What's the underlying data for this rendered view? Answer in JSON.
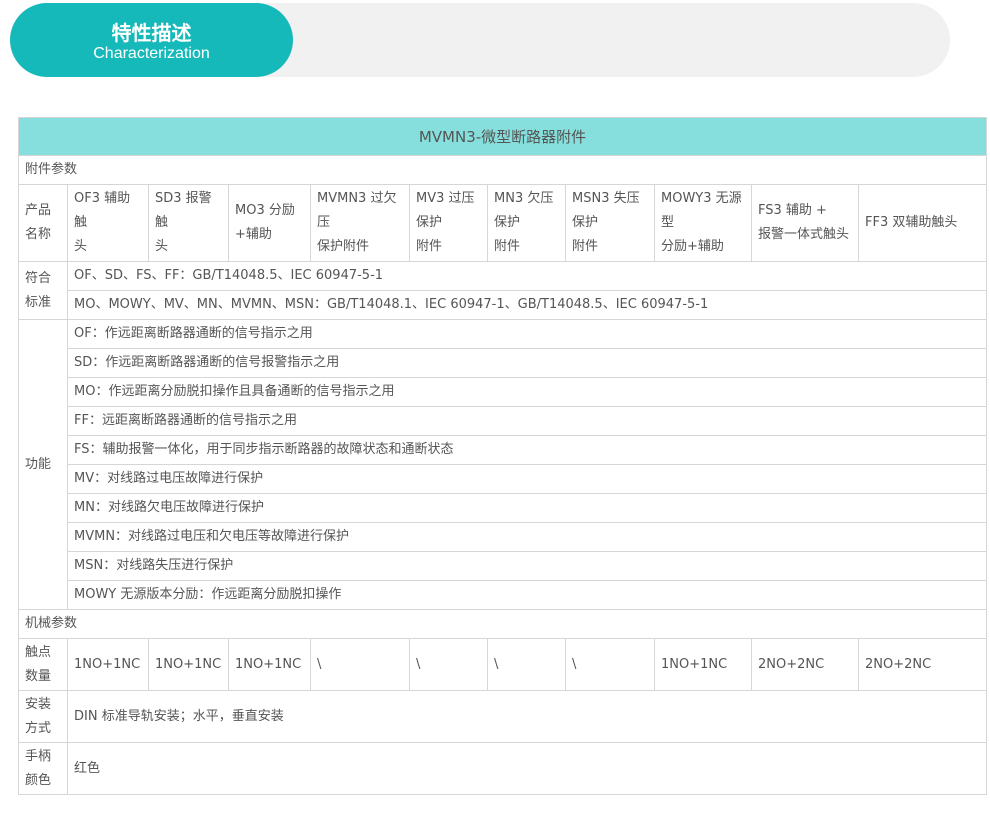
{
  "header": {
    "title_cn": "特性描述",
    "title_en": "Characterization"
  },
  "table": {
    "title": "MVMN3-微型断路器附件",
    "section_params": "附件参数",
    "product_label": "产品名称",
    "products": [
      "OF3 辅助触头",
      "SD3 报警触头",
      "MO3 分励+辅助",
      "MVMN3 过欠压保护附件",
      "MV3 过压保护附件",
      "MN3 欠压保护附件",
      "MSN3 失压保护附件",
      "MOWY3 无源型分励+辅助",
      "FS3 辅助 +报警一体式触头",
      "FF3 双辅助触头"
    ],
    "products_lines": [
      [
        "OF3 辅助触",
        "头"
      ],
      [
        "SD3 报警触",
        "头"
      ],
      [
        "MO3 分励",
        "+辅助"
      ],
      [
        "MVMN3 过欠",
        "压",
        "保护附件"
      ],
      [
        "MV3 过压",
        "保护",
        "附件"
      ],
      [
        "MN3 欠压",
        "保护",
        "附件"
      ],
      [
        "MSN3 失压",
        "保护",
        "附件"
      ],
      [
        "MOWY3 无源",
        "型",
        "分励+辅助"
      ],
      [
        "FS3 辅助 +",
        "报警一体式触头"
      ],
      [
        "FF3 双辅助触头"
      ]
    ],
    "standard_label": "符合标准",
    "standards": [
      "OF、SD、FS、FF：GB/T14048.5、IEC 60947-5-1",
      "MO、MOWY、MV、MN、MVMN、MSN：GB/T14048.1、IEC 60947-1、GB/T14048.5、IEC 60947-5-1"
    ],
    "function_label": "功能",
    "functions": [
      "OF：作远距离断路器通断的信号指示之用",
      "SD：作远距离断路器通断的信号报警指示之用",
      "MO：作远距离分励脱扣操作且具备通断的信号指示之用",
      "FF：远距离断路器通断的信号指示之用",
      "FS：辅助报警一体化，用于同步指示断路器的故障状态和通断状态",
      "MV：对线路过电压故障进行保护",
      "MN：对线路欠电压故障进行保护",
      "MVMN：对线路过电压和欠电压等故障进行保护",
      "MSN：对线路失压进行保护",
      "MOWY 无源版本分励：作远距离分励脱扣操作"
    ],
    "section_mech": "机械参数",
    "contacts_label": "触点数量",
    "contacts": [
      "1NO+1NC",
      "1NO+1NC",
      "1NO+1NC",
      "\\",
      "\\",
      "\\",
      "\\",
      "1NO+1NC",
      "2NO+2NC",
      "2NO+2NC"
    ],
    "mount_label": "安装方式",
    "mount": "DIN 标准导轨安装；水平，垂直安装",
    "handle_label": "手柄颜色",
    "handle": "红色"
  }
}
